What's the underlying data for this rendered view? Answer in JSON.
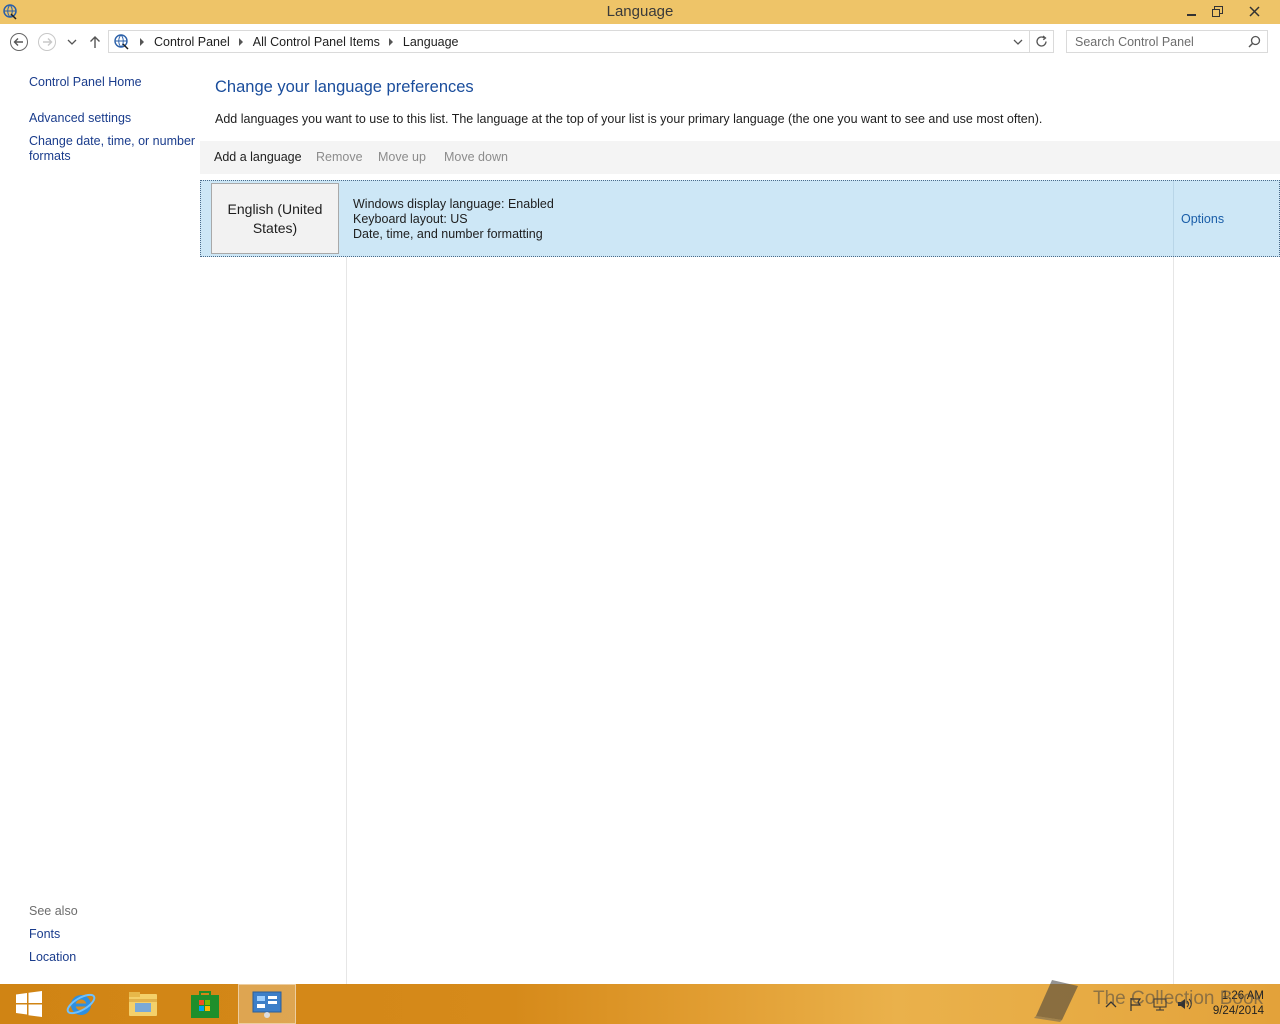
{
  "window": {
    "title": "Language",
    "controls": {
      "minimize": "minimize",
      "restore": "restore",
      "close": "close"
    }
  },
  "address": {
    "breadcrumbs": [
      "Control Panel",
      "All Control Panel Items",
      "Language"
    ],
    "search_placeholder": "Search Control Panel"
  },
  "sidebar": {
    "home": "Control Panel Home",
    "links": [
      "Advanced settings",
      "Change date, time, or number formats"
    ],
    "see_also_label": "See also",
    "see_also": [
      "Fonts",
      "Location"
    ]
  },
  "main": {
    "title": "Change your language preferences",
    "description": "Add languages you want to use to this list. The language at the top of your list is your primary language (the one you want to see and use most often).",
    "toolbar": {
      "add": "Add a language",
      "remove": "Remove",
      "move_up": "Move up",
      "move_down": "Move down"
    },
    "languages": [
      {
        "name": "English (United States)",
        "details": [
          "Windows display language: Enabled",
          "Keyboard layout: US",
          "Date, time, and number formatting"
        ],
        "options": "Options"
      }
    ]
  },
  "taskbar": {
    "apps": [
      "start-icon",
      "internet-explorer-icon",
      "file-explorer-icon",
      "store-icon",
      "control-panel-icon"
    ],
    "time": "1:26 AM",
    "date": "9/24/2014",
    "watermark": "The Collection Book"
  },
  "colors": {
    "titlebar": "#eec468",
    "link": "#1a3c8c",
    "heading": "#1a4d9c",
    "selection": "#cde7f6",
    "taskbar": "#d68a1a"
  }
}
